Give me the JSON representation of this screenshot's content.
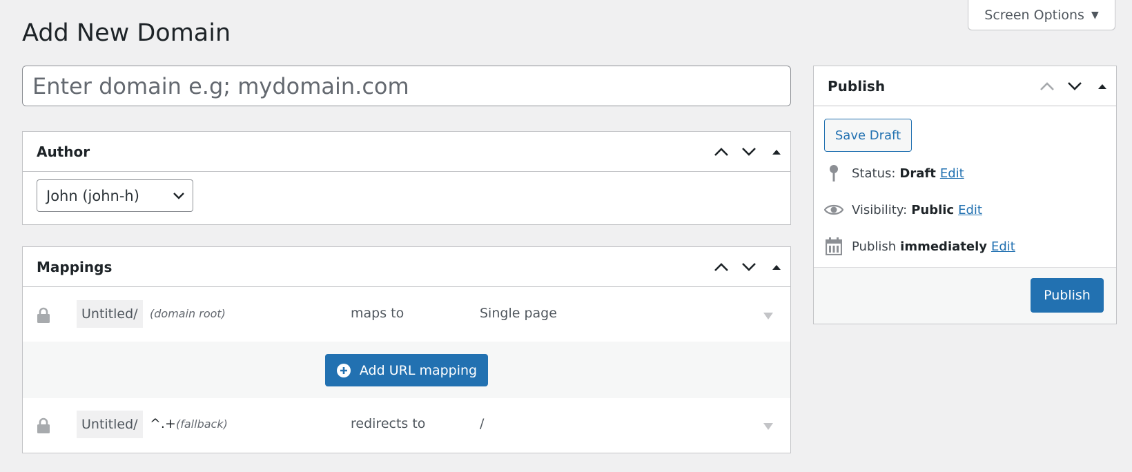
{
  "screen_options": {
    "label": "Screen Options"
  },
  "page": {
    "title": "Add New Domain"
  },
  "domain_input": {
    "placeholder": "Enter domain e.g; mydomain.com",
    "value": ""
  },
  "author": {
    "title": "Author",
    "selected": "John (john-h)"
  },
  "mappings": {
    "title": "Mappings",
    "rows": [
      {
        "path": "Untitled/",
        "regex": "",
        "note": "(domain root)",
        "verb": "maps to",
        "target": "Single page"
      },
      {
        "path": "Untitled/",
        "regex": "^.+",
        "note": "(fallback)",
        "verb": "redirects to",
        "target": "/"
      }
    ],
    "add_label": "Add URL mapping"
  },
  "publish": {
    "title": "Publish",
    "save_draft": "Save Draft",
    "status_label": "Status:",
    "status_value": "Draft",
    "visibility_label": "Visibility:",
    "visibility_value": "Public",
    "schedule_label": "Publish",
    "schedule_value": "immediately",
    "edit_label": "Edit",
    "publish_button": "Publish"
  },
  "colors": {
    "accent": "#2271b1",
    "background": "#f0f0f1",
    "border": "#c3c4c7"
  },
  "icons": {
    "lock": "lock-icon",
    "pin": "pin-icon",
    "eye": "eye-icon",
    "calendar": "calendar-icon",
    "plus": "plus-circle-icon"
  }
}
